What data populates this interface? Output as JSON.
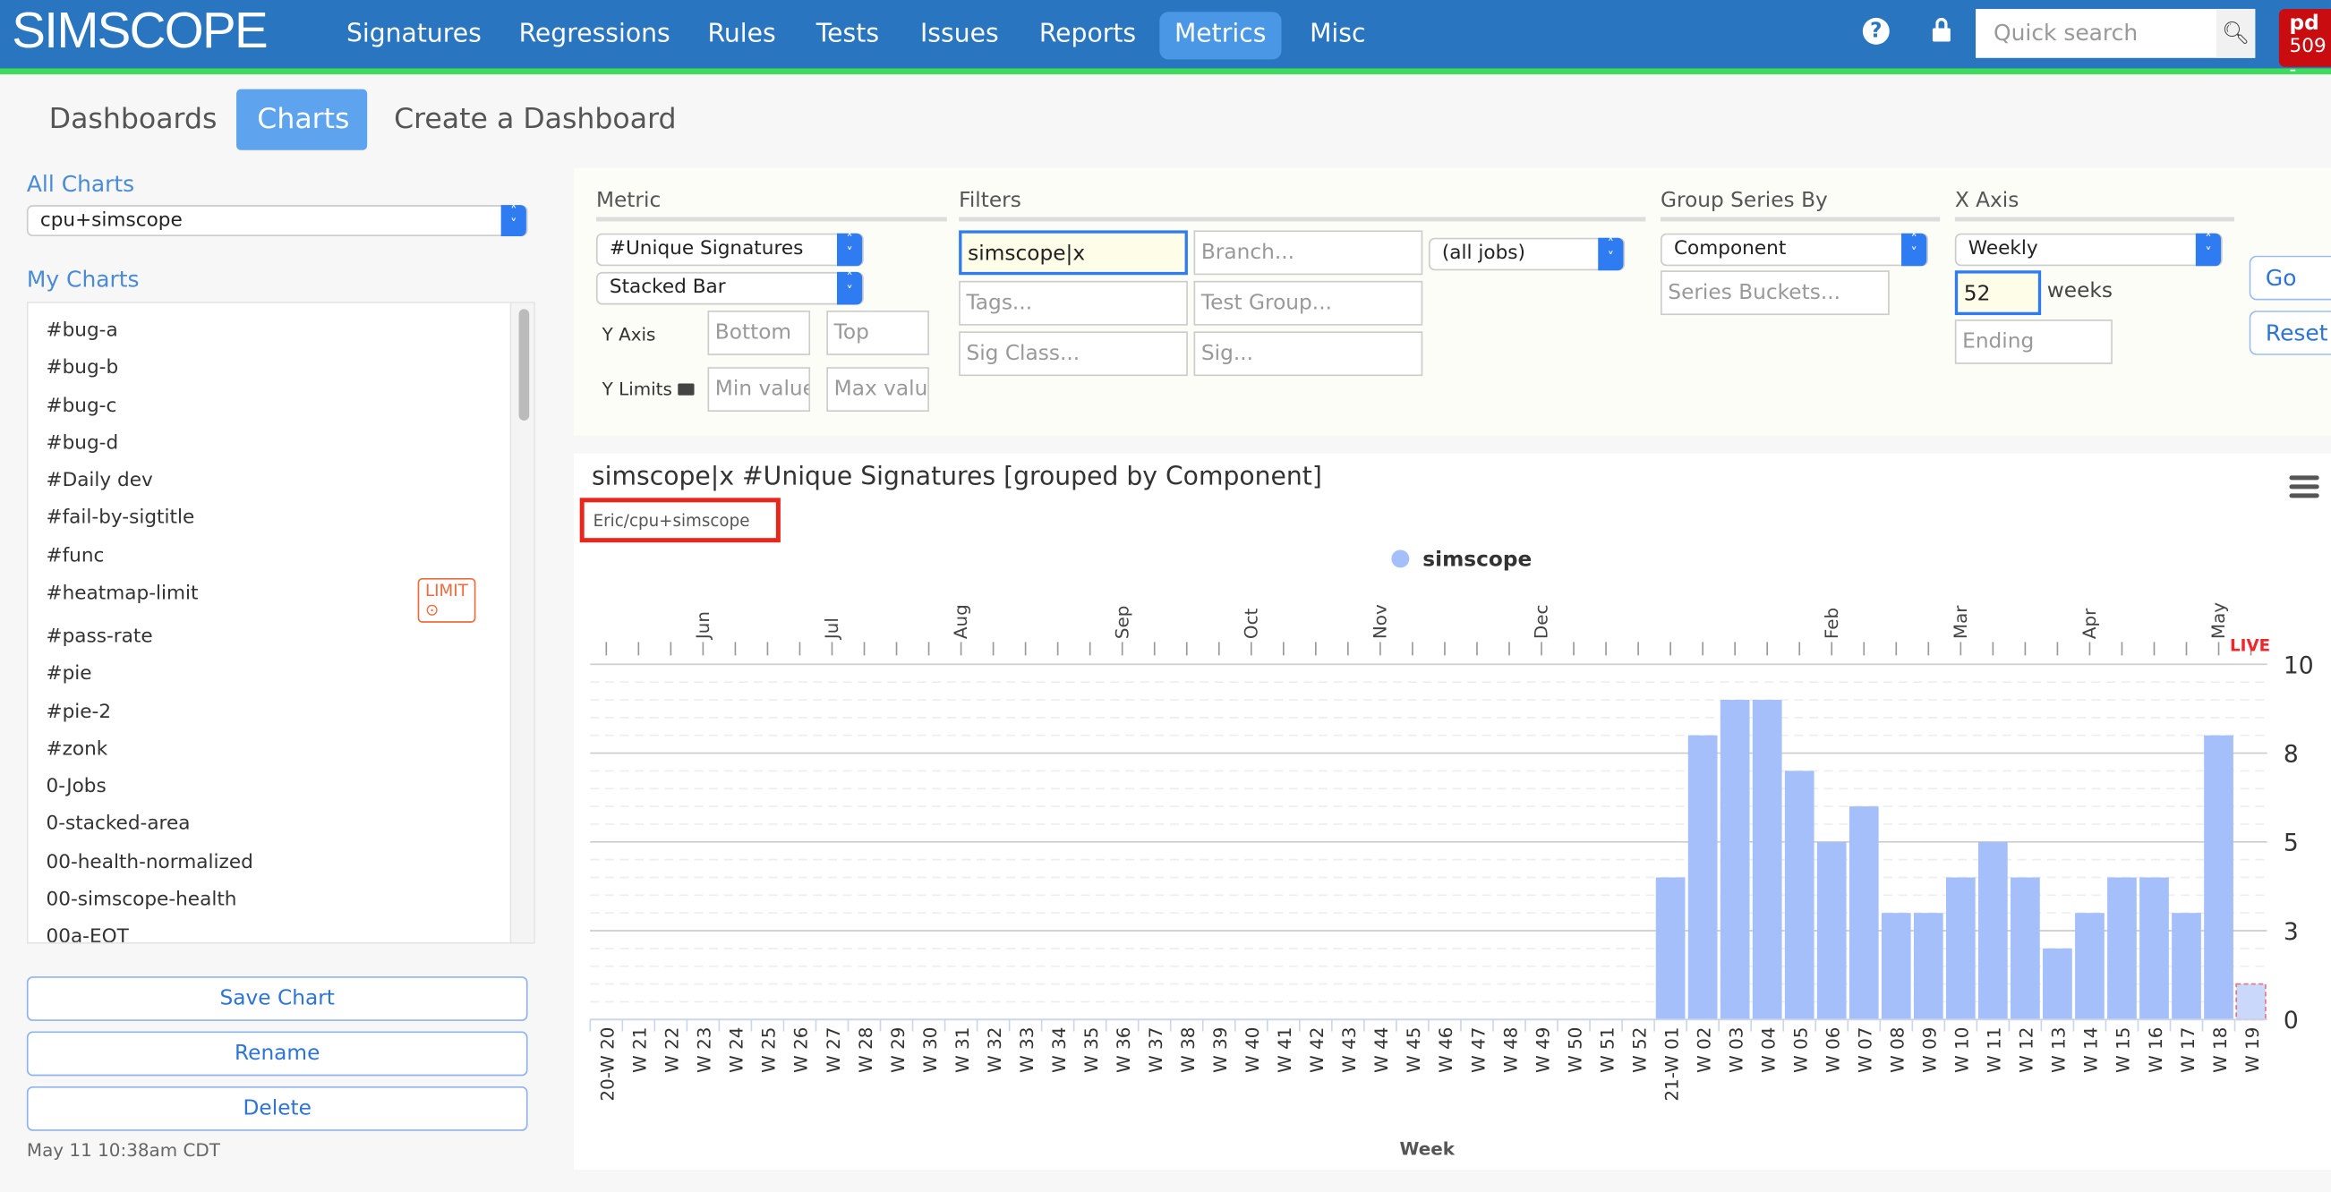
{
  "nav": {
    "logo": "SIMSCOPE",
    "items": [
      "Signatures",
      "Regressions",
      "Rules",
      "Tests",
      "Issues",
      "Reports",
      "Metrics",
      "Misc"
    ],
    "active": "Metrics",
    "search_placeholder": "Quick search",
    "user_name": "pd",
    "user_count": "509 -",
    "colors": {
      "bar": "#2a75bf",
      "accent_line": "#3ddc5a",
      "user": "#c90c0f"
    }
  },
  "subtabs": {
    "items": [
      "Dashboards",
      "Charts",
      "Create a Dashboard"
    ],
    "active": "Charts"
  },
  "sidebar": {
    "all_charts_label": "All Charts",
    "all_charts_value": "cpu+simscope",
    "my_charts_label": "My Charts",
    "items": [
      {
        "label": "#bug-a"
      },
      {
        "label": "#bug-b"
      },
      {
        "label": "#bug-c"
      },
      {
        "label": "#bug-d"
      },
      {
        "label": "#Daily dev"
      },
      {
        "label": "#fail-by-sigtitle"
      },
      {
        "label": "#func"
      },
      {
        "label": "#heatmap-limit",
        "badge": "LIMIT ⊙"
      },
      {
        "label": "#pass-rate"
      },
      {
        "label": "#pie"
      },
      {
        "label": "#pie-2"
      },
      {
        "label": "#zonk"
      },
      {
        "label": "0-Jobs"
      },
      {
        "label": "0-stacked-area"
      },
      {
        "label": "00-health-normalized"
      },
      {
        "label": "00-simscope-health"
      },
      {
        "label": "00a-EOT"
      }
    ],
    "save": "Save Chart",
    "rename": "Rename",
    "delete": "Delete",
    "timestamp": "May 11 10:38am CDT"
  },
  "form": {
    "metric_header": "Metric",
    "metric": "#Unique Signatures",
    "chart_type": "Stacked Bar",
    "y_axis_label": "Y Axis",
    "y_bottom_ph": "Bottom",
    "y_top_ph": "Top",
    "y_limits_label": "Y Limits",
    "y_min_ph": "Min value",
    "y_max_ph": "Max value",
    "filters_header": "Filters",
    "filter_value": "simscope|x",
    "branch_ph": "Branch...",
    "jobs": "(all jobs)",
    "tags_ph": "Tags...",
    "testgroup_ph": "Test Group...",
    "sigclass_ph": "Sig Class...",
    "sig_ph": "Sig...",
    "group_header": "Group Series By",
    "group": "Component",
    "buckets_ph": "Series Buckets...",
    "xaxis_header": "X Axis",
    "interval": "Weekly",
    "weeks": "52",
    "weeks_label": "weeks",
    "ending_ph": "Ending",
    "go": "Go",
    "reset": "Reset"
  },
  "chart": {
    "title": "simscope|x #Unique Signatures [grouped by Component]",
    "subtitle": "Eric/cpu+simscope"
  },
  "chart_data": {
    "type": "bar",
    "stacked": true,
    "title": "simscope|x #Unique Signatures [grouped by Component]",
    "xlabel": "Week",
    "ylabel": "",
    "legend_position": "top-center",
    "grid": true,
    "categories": [
      "20-W 20",
      "W 21",
      "W 22",
      "W 23",
      "W 24",
      "W 25",
      "W 26",
      "W 27",
      "W 28",
      "W 29",
      "W 30",
      "W 31",
      "W 32",
      "W 33",
      "W 34",
      "W 35",
      "W 36",
      "W 37",
      "W 38",
      "W 39",
      "W 40",
      "W 41",
      "W 42",
      "W 43",
      "W 44",
      "W 45",
      "W 46",
      "W 47",
      "W 48",
      "W 49",
      "W 50",
      "W 51",
      "W 52",
      "21-W 01",
      "W 02",
      "W 03",
      "W 04",
      "W 05",
      "W 06",
      "W 07",
      "W 08",
      "W 09",
      "W 10",
      "W 11",
      "W 12",
      "W 13",
      "W 14",
      "W 15",
      "W 16",
      "W 17",
      "W 18",
      "W 19"
    ],
    "series": [
      {
        "name": "simscope",
        "color": "#a5bffa",
        "values": [
          0,
          0,
          0,
          0,
          0,
          0,
          0,
          0,
          0,
          0,
          0,
          0,
          0,
          0,
          0,
          0,
          0,
          0,
          0,
          0,
          0,
          0,
          0,
          0,
          0,
          0,
          0,
          0,
          0,
          0,
          0,
          0,
          0,
          4,
          8,
          9,
          9,
          7,
          5,
          6,
          3,
          3,
          4,
          5,
          4,
          2,
          3,
          4,
          4,
          3,
          8,
          1
        ]
      }
    ],
    "ylim": [
      0,
      10
    ],
    "y_ticks": [
      {
        "value": 0,
        "label": "0"
      },
      {
        "value": 2.5,
        "label": "3"
      },
      {
        "value": 5,
        "label": "5"
      },
      {
        "value": 7.5,
        "label": "8"
      },
      {
        "value": 10,
        "label": "10"
      }
    ],
    "y_axis_position": "right",
    "top_axis_months": [
      "Jun",
      "Jul",
      "Aug",
      "Sep",
      "Oct",
      "Nov",
      "Dec",
      "Feb",
      "Mar",
      "Apr",
      "May"
    ],
    "live_label": "LIVE",
    "live_category": "W 19"
  }
}
